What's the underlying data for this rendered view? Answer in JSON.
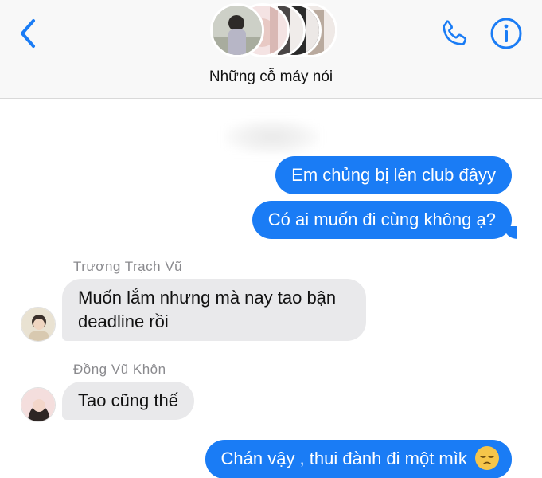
{
  "header": {
    "group_name": "Những cỗ máy nói",
    "icons": {
      "back": "chevron-left-icon",
      "call": "phone-icon",
      "info": "info-icon"
    },
    "accent_color": "#1a7cf5"
  },
  "messages": [
    {
      "direction": "out",
      "text": "Em chủng bị lên club đâyy"
    },
    {
      "direction": "out",
      "text": "Có ai muốn đi cùng không ạ?"
    },
    {
      "direction": "in",
      "sender": "Trương Trạch Vũ",
      "text": "Muốn lắm nhưng mà nay tao bận deadline rồi"
    },
    {
      "direction": "in",
      "sender": "Đồng Vũ Khôn",
      "text": "Tao cũng thế"
    },
    {
      "direction": "out",
      "text": "Chán vậy , thui đành đi một mìk",
      "emoji": "pensive-face-emoji"
    }
  ]
}
